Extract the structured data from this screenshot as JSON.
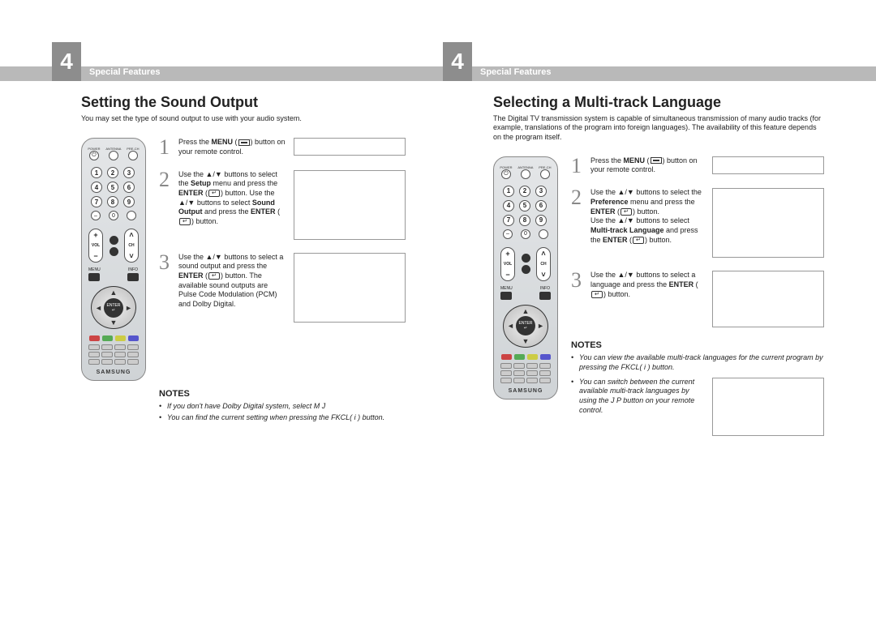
{
  "header": {
    "chapter_number": "4",
    "chapter_label": "Special Features"
  },
  "left_page": {
    "title": "Setting the Sound Output",
    "intro": "You may set the type of sound output to use with your audio system.",
    "steps": [
      {
        "num": "1",
        "text_before": "Press the ",
        "bold1": "MENU",
        "text_mid": " (",
        "text_after": ") button on your remote control."
      },
      {
        "num": "2",
        "text": "Use the ▲/▼ buttons to select the Setup menu and press the ENTER button. Use the ▲/▼ buttons to select Sound Output and press the ENTER button.",
        "bold_setup": "Setup",
        "bold_enter": "ENTER",
        "bold_sound": "Sound Output"
      },
      {
        "num": "3",
        "text": "Use the ▲/▼ buttons to select a sound output and press the ENTER button. The available sound outputs are Pulse Code Modulation (PCM) and Dolby Digital.",
        "bold_enter": "ENTER"
      }
    ],
    "notes_heading": "NOTES",
    "notes": [
      "If you don't have Dolby Digital system, select M    J",
      "You can find the current setting when pressing the FKCL( i ) button."
    ]
  },
  "right_page": {
    "title": "Selecting a Multi-track Language",
    "intro": "The Digital TV transmission system is capable of simultaneous transmission of many audio tracks (for example, translations of the program into foreign languages). The availability of this feature depends on the program itself.",
    "steps": [
      {
        "num": "1",
        "text_before": "Press the ",
        "bold1": "MENU",
        "text_mid": " (",
        "text_after": ") button on your remote control."
      },
      {
        "num": "2",
        "s2_line1_a": "Use the ▲/▼ buttons to select the ",
        "s2_pref": "Preference",
        "s2_line1_b": " menu and press the ",
        "s2_enter": "ENTER",
        "s2_line1_c": " button.",
        "s2_line2_a": "Use the ▲/▼ buttons to select ",
        "s2_mtl": "Multi-track Language",
        "s2_line2_b": " and press the ",
        "s2_line2_c": " button."
      },
      {
        "num": "3",
        "s3_a": "Use the ▲/▼ buttons to select a language and press the ",
        "s3_enter": "ENTER",
        "s3_b": " button."
      }
    ],
    "notes_heading": "NOTES",
    "notes": [
      "You can view the available multi-track languages for the current program by pressing the FKCL( i ) button.",
      "You can switch between the current available multi-track languages by using the J    P button on your remote control."
    ]
  },
  "remote": {
    "brand": "SAMSUNG",
    "enter": "ENTER",
    "menu": "MENU",
    "info": "INFO",
    "power": "POWER",
    "antenna": "ANTENNA",
    "prech": "PRE-CH",
    "vol": "VOL",
    "ch": "CH",
    "numbers": [
      "1",
      "2",
      "3",
      "4",
      "5",
      "6",
      "7",
      "8",
      "9",
      "0"
    ],
    "dash": "–",
    "colors": [
      "#c44",
      "#5a5",
      "#cc4",
      "#55c"
    ]
  }
}
